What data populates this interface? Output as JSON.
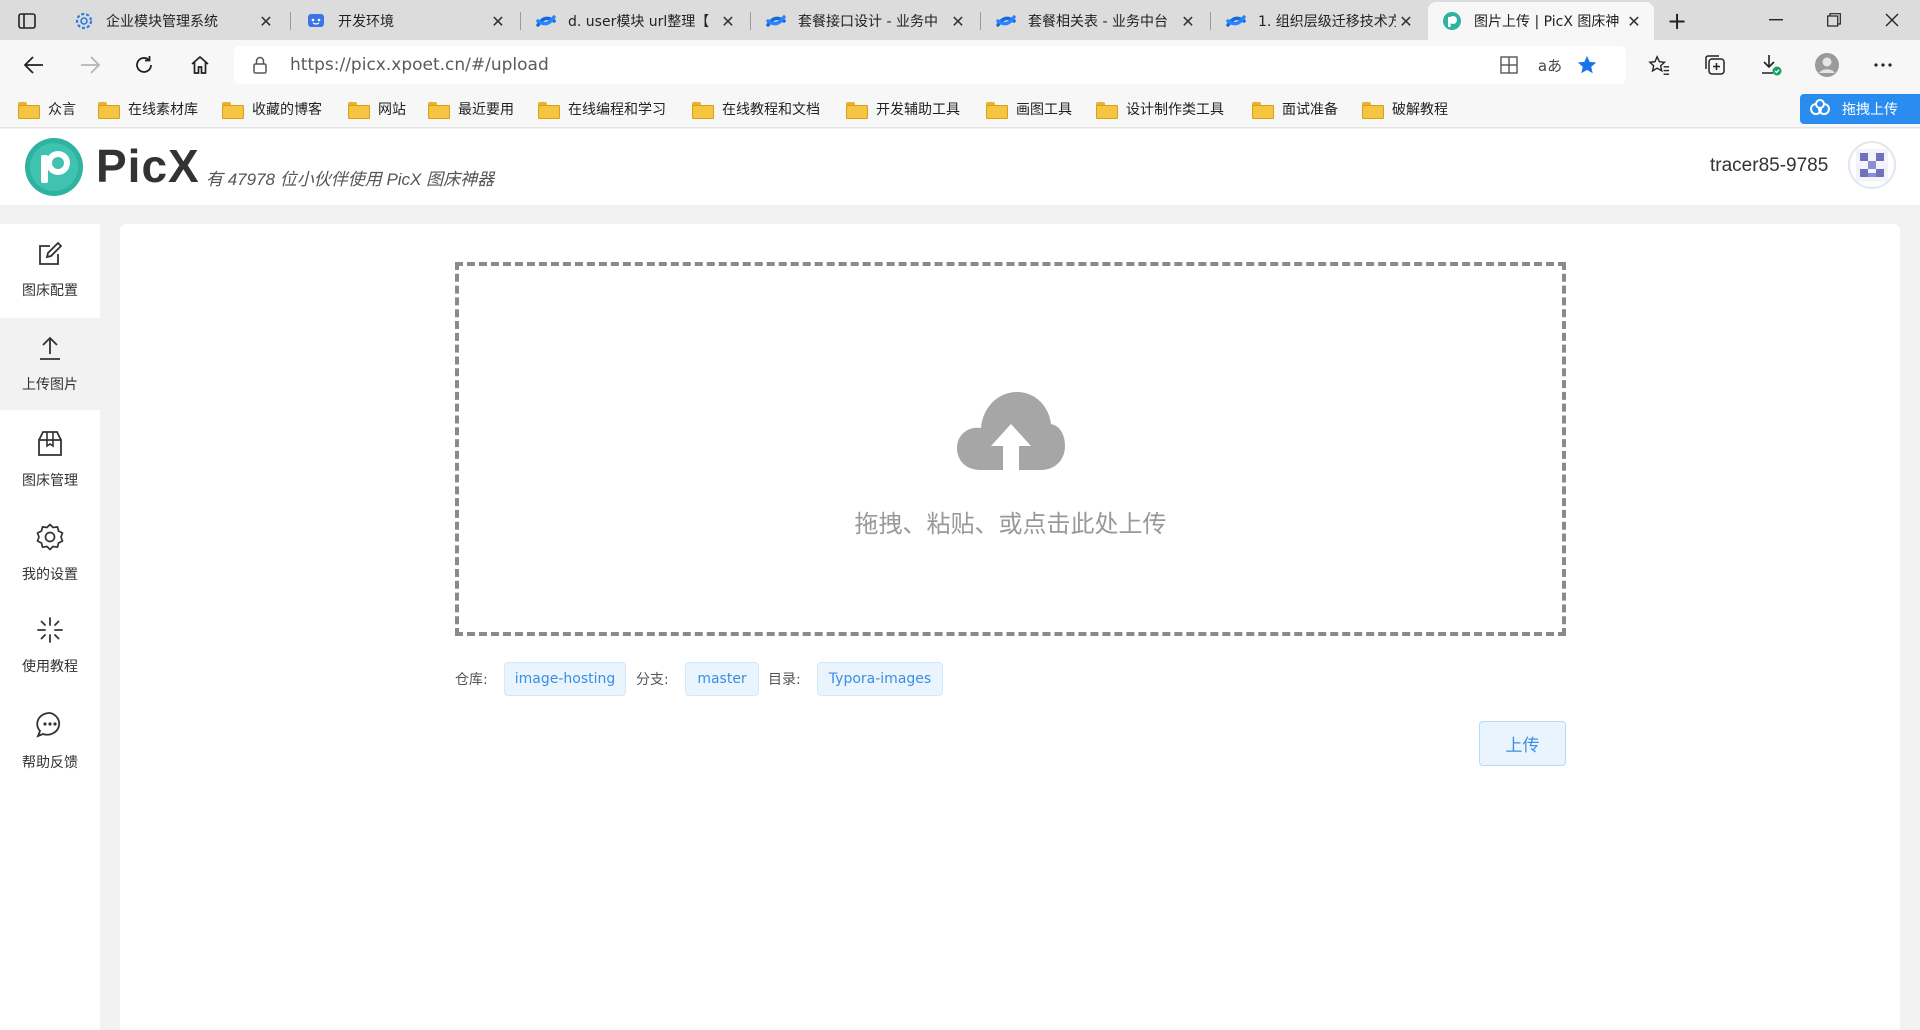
{
  "browser": {
    "tabs": [
      {
        "title": "企业模块管理系统",
        "favicon": "gear-favicon"
      },
      {
        "title": "开发环境",
        "favicon": "chat-favicon"
      },
      {
        "title": "d. user模块 url整理【",
        "favicon": "confluence-favicon"
      },
      {
        "title": "套餐接口设计 - 业务中",
        "favicon": "confluence-favicon"
      },
      {
        "title": "套餐相关表 - 业务中台",
        "favicon": "confluence-favicon"
      },
      {
        "title": "1. 组织层级迁移技术方",
        "favicon": "confluence-favicon"
      },
      {
        "title": "图片上传 | PicX 图床神",
        "favicon": "picx-favicon",
        "active": true
      }
    ],
    "url": "https://picx.xpoet.cn/#/upload",
    "bookmarks": [
      "众言",
      "在线素材库",
      "收藏的博客",
      "网站",
      "最近要用",
      "在线编程和学习",
      "在线教程和文档",
      "开发辅助工具",
      "画图工具",
      "设计制作类工具",
      "面试准备",
      "破解教程"
    ],
    "extension_label": "拖拽上传",
    "read_aloud": "aあ"
  },
  "app": {
    "brand": "PicX",
    "tagline": "有 47978 位小伙伴使用 PicX 图床神器",
    "username": "tracer85-9785"
  },
  "sidebar": {
    "items": [
      {
        "label": "图床配置",
        "icon": "edit-icon"
      },
      {
        "label": "上传图片",
        "icon": "upload-icon",
        "active": true
      },
      {
        "label": "图床管理",
        "icon": "package-icon"
      },
      {
        "label": "我的设置",
        "icon": "gear-icon"
      },
      {
        "label": "使用教程",
        "icon": "sparkle-icon"
      },
      {
        "label": "帮助反馈",
        "icon": "chat-icon"
      }
    ]
  },
  "upload": {
    "hint": "拖拽、粘贴、或点击此处上传",
    "repo_label": "仓库:",
    "repo_value": "image-hosting",
    "branch_label": "分支:",
    "branch_value": "master",
    "dir_label": "目录:",
    "dir_value": "Typora-images",
    "button": "上传"
  },
  "colors": {
    "accent": "#3a8ee6",
    "chip_bg": "#eaf4fd",
    "bookmark_folder": "#f5c542",
    "extension": "#2b8cf0"
  }
}
